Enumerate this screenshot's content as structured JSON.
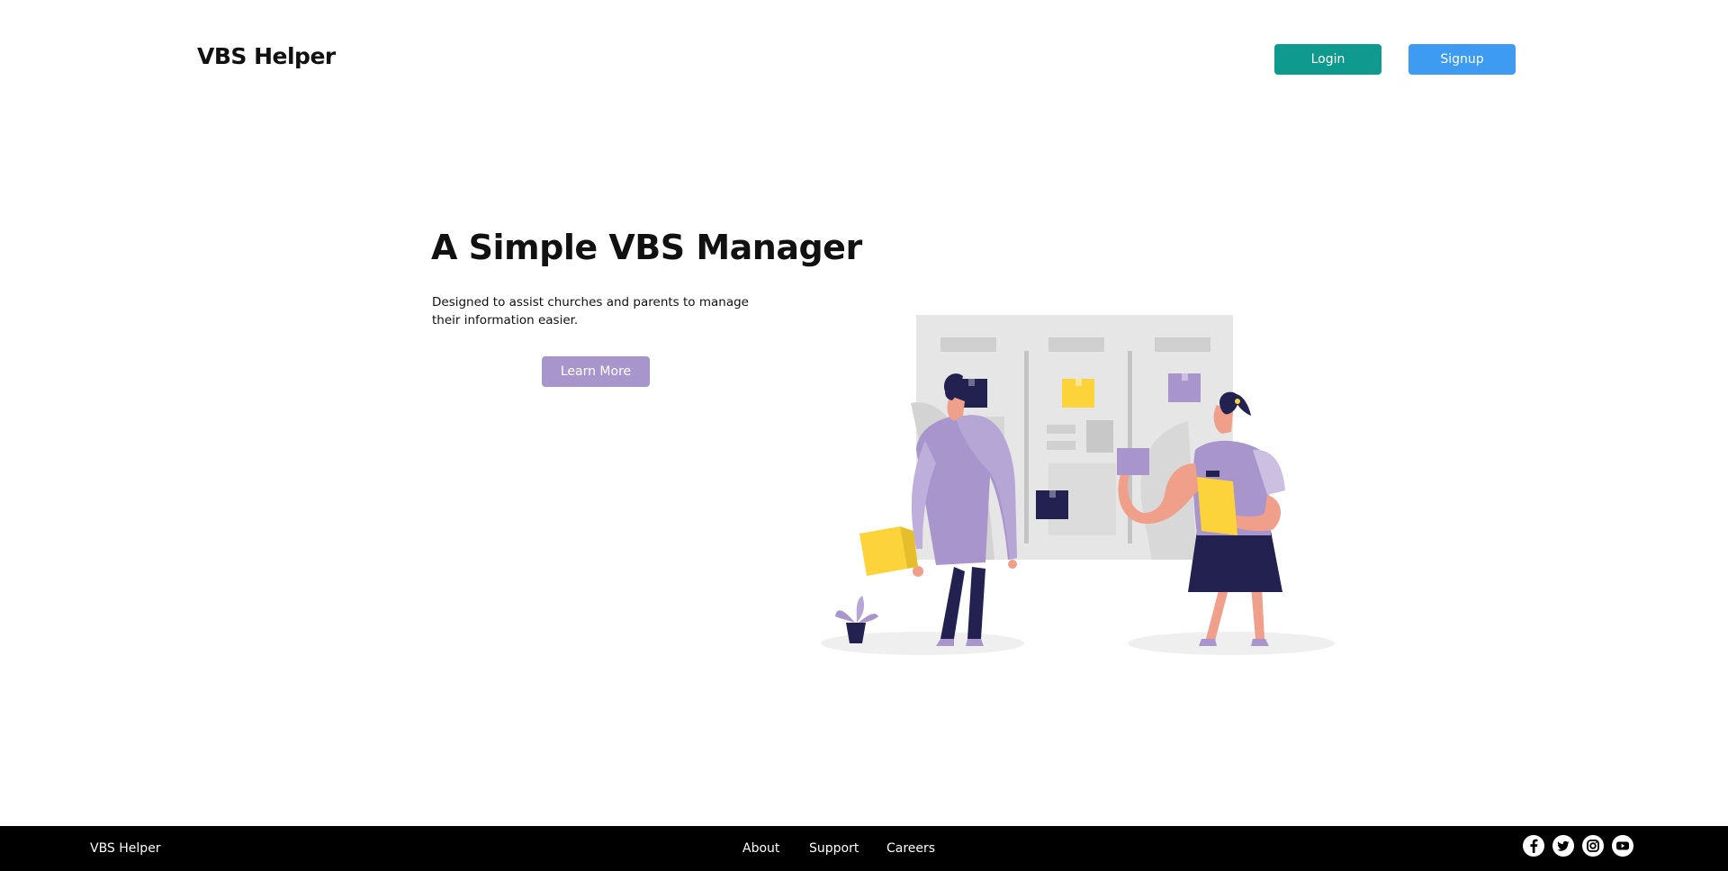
{
  "header": {
    "brand": "VBS Helper",
    "login_label": "Login",
    "signup_label": "Signup"
  },
  "hero": {
    "title": "A Simple VBS Manager",
    "description": "Designed to assist churches and parents to manage their information easier.",
    "cta_label": "Learn More"
  },
  "illustration": {
    "icon": "team-kanban-board-illustration",
    "colors": {
      "purple": "#a895cc",
      "navy": "#23214f",
      "yellow": "#fcd33a",
      "skin": "#f0a08a",
      "board": "#e6e6e6"
    }
  },
  "footer": {
    "brand": "VBS Helper",
    "links": [
      "About",
      "Support",
      "Careers"
    ],
    "social_icons": [
      "facebook-icon",
      "twitter-icon",
      "instagram-icon",
      "youtube-icon"
    ]
  },
  "colors": {
    "login": "#0e9a8c",
    "signup": "#3d9bf2",
    "cta": "#a895cc",
    "footer_bg": "#000000"
  }
}
